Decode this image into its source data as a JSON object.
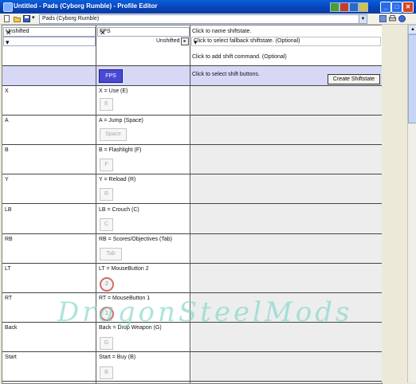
{
  "window": {
    "title": "Untitled - Pads (Cyborg Rumble) - Profile Editor",
    "buttons": [
      "_",
      "□",
      "✕"
    ]
  },
  "toolbar": {
    "profile": "Pads (Cyborg Rumble)"
  },
  "header": {
    "shiftstate_left": "Unshifted",
    "shiftstate_mid": "FPS",
    "shiftstate_mid_sub": "Unshifted",
    "name_hint": "Click to name shiftstate.",
    "fallback_hint": "Click to select fallback shiftstate. (Optional)",
    "command_hint": "Click to add shift command. (Optional)",
    "shift_buttons_hint": "Click to select shift buttons.",
    "fps_button": "FPS",
    "create_button": "Create Shiftstate"
  },
  "rows": [
    {
      "button": "X",
      "command": "X = Use (E)",
      "key": "E",
      "type": "key"
    },
    {
      "button": "A",
      "command": "A = Jump (Space)",
      "key": "Space",
      "type": "key"
    },
    {
      "button": "B",
      "command": "B = Flashlight (F)",
      "key": "F",
      "type": "key"
    },
    {
      "button": "Y",
      "command": "Y = Reload (R)",
      "key": "R",
      "type": "key"
    },
    {
      "button": "LB",
      "command": "LB = Crouch (C)",
      "key": "C",
      "type": "key"
    },
    {
      "button": "RB",
      "command": "RB = Scores/Objectives (Tab)",
      "key": "Tab",
      "type": "key"
    },
    {
      "button": "LT",
      "command": "LT = MouseButton 2",
      "key": "2",
      "type": "mouse"
    },
    {
      "button": "RT",
      "command": "RT = MouseButton 1",
      "key": "1",
      "type": "mouse"
    },
    {
      "button": "Back",
      "command": "Back = Drop Weapon (G)",
      "key": "G",
      "type": "key"
    },
    {
      "button": "Start",
      "command": "Start = Buy (B)",
      "key": "B",
      "type": "key"
    }
  ],
  "watermark": "DragonSteelMods"
}
